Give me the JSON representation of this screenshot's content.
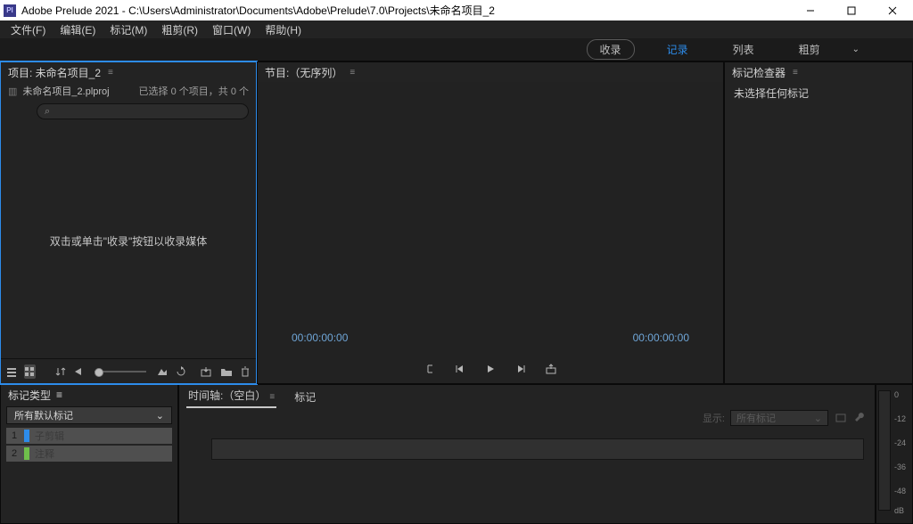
{
  "titlebar": {
    "app_icon_label": "Pl",
    "title": "Adobe Prelude 2021 - C:\\Users\\Administrator\\Documents\\Adobe\\Prelude\\7.0\\Projects\\未命名项目_2"
  },
  "menubar": {
    "file": "文件(F)",
    "edit": "编辑(E)",
    "marker": "标记(M)",
    "rough": "粗剪(R)",
    "window": "窗口(W)",
    "help": "帮助(H)"
  },
  "workspace": {
    "ingest": "收录",
    "log": "记录",
    "list": "列表",
    "rough": "粗剪"
  },
  "project_panel": {
    "title": "项目: 未命名项目_2",
    "file": "未命名项目_2.plproj",
    "counter": "已选择 0 个项目，共 0 个",
    "search_placeholder": "",
    "search_icon": "⌕",
    "empty_hint": "双击或单击\"收录\"按钮以收录媒体"
  },
  "program_panel": {
    "title": "节目:（无序列）",
    "tc_left": "00:00:00:00",
    "tc_right": "00:00:00:00"
  },
  "marker_inspector": {
    "title": "标记检查器",
    "empty": "未选择任何标记"
  },
  "marker_types": {
    "title": "标记类型",
    "selector": "所有默认标记",
    "items": [
      {
        "num": "1",
        "label": "子剪辑",
        "color": "#2d8ceb"
      },
      {
        "num": "2",
        "label": "注释",
        "color": "#6fbf4b"
      }
    ]
  },
  "timeline": {
    "tab_timeline": "时间轴:（空白）",
    "tab_markers": "标记",
    "filter_label": "显示:",
    "filter_value": "所有标记"
  },
  "audio_meter": {
    "ticks": [
      "0",
      "",
      "-12",
      "",
      "-24",
      "",
      "-36",
      "",
      "-48",
      "",
      "dB"
    ]
  }
}
